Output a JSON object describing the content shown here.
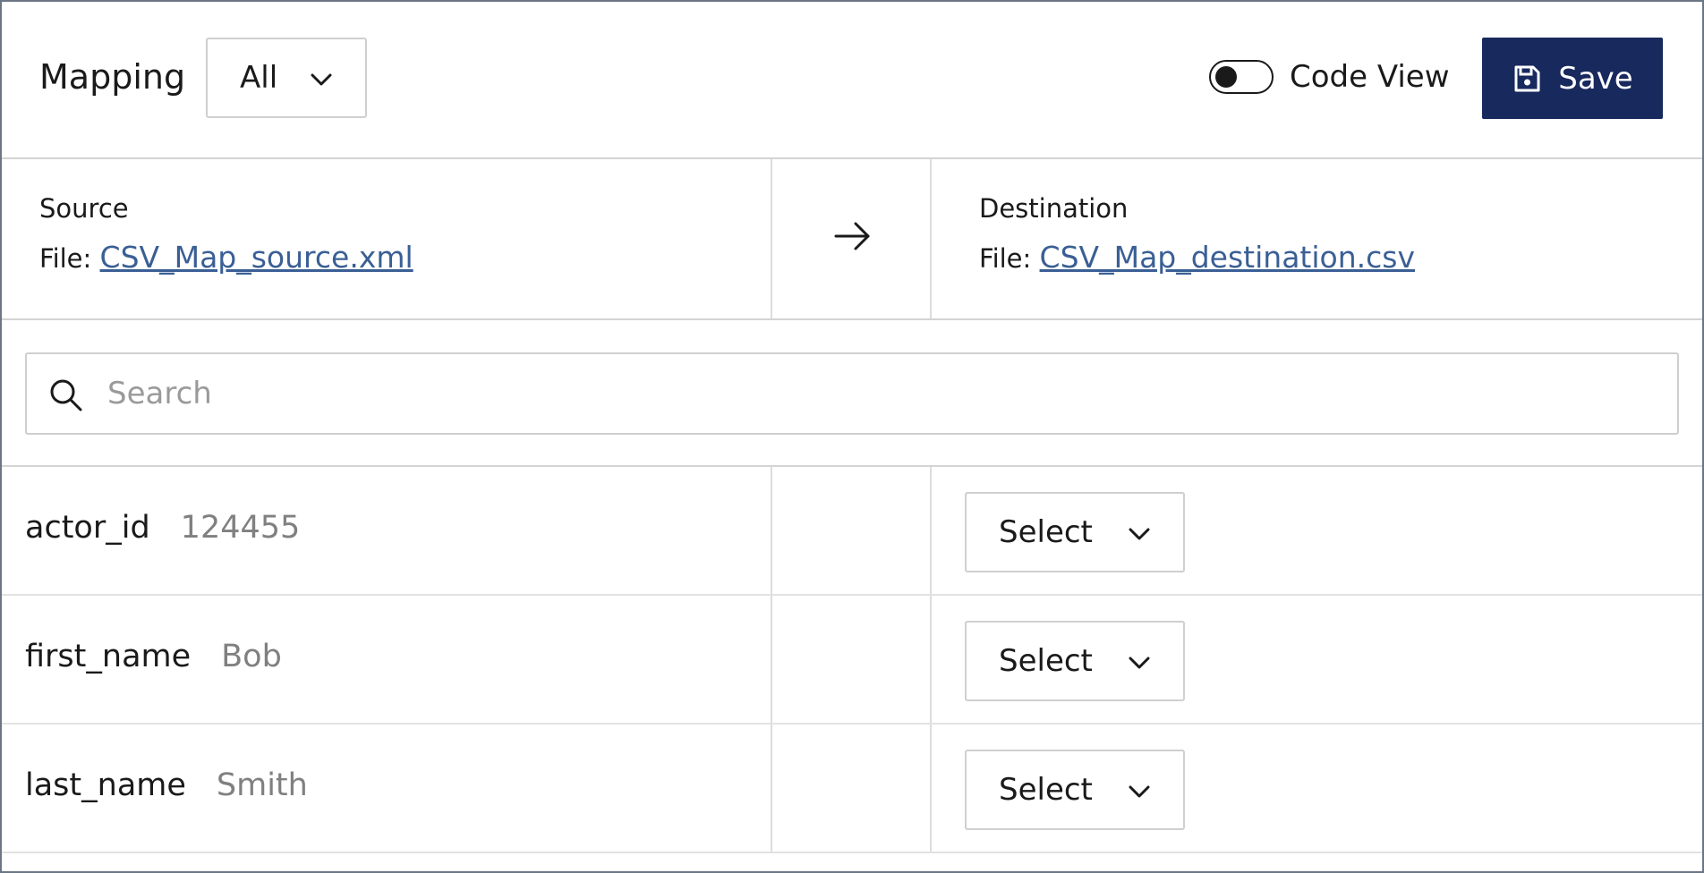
{
  "header": {
    "title": "Mapping",
    "filter_value": "All",
    "code_view_label": "Code View",
    "code_view_on": false,
    "save_label": "Save",
    "save_color": "#17295d"
  },
  "source": {
    "heading": "Source",
    "file_prefix": "File:",
    "file_name": "CSV_Map_source.xml"
  },
  "destination": {
    "heading": "Destination",
    "file_prefix": "File:",
    "file_name": "CSV_Map_destination.csv"
  },
  "search": {
    "placeholder": "Search",
    "value": ""
  },
  "rows": [
    {
      "field": "actor_id",
      "sample": "124455",
      "select_label": "Select"
    },
    {
      "field": "first_name",
      "sample": "Bob",
      "select_label": "Select"
    },
    {
      "field": "last_name",
      "sample": "Smith",
      "select_label": "Select"
    }
  ],
  "icons": {
    "filter_chevron": "chevron-down-icon",
    "save": "save-icon",
    "arrow": "arrow-right-icon",
    "search": "search-icon",
    "select_chevron": "chevron-down-icon"
  },
  "colors": {
    "link": "#3a5f95",
    "border": "#6b7785"
  }
}
